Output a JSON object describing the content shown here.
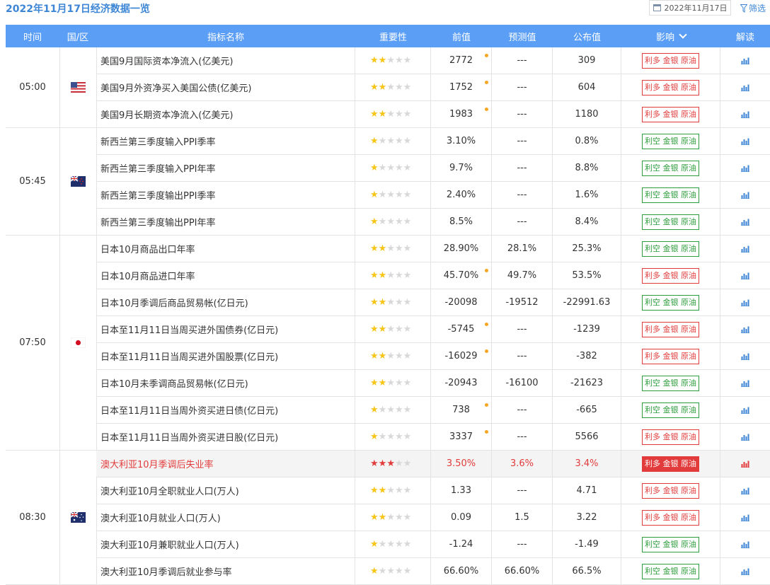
{
  "page_title": "2022年11月17日经济数据一览",
  "date_picker": {
    "value": "2022年11月17日"
  },
  "filter_label": "筛选",
  "columns": [
    "时间",
    "国/区",
    "指标名称",
    "重要性",
    "前值",
    "预测值",
    "公布值",
    "影响",
    "解读"
  ],
  "colors": {
    "header_bg": "#5b9ef5",
    "title": "#3d86d6",
    "bullish": "#e23b3b",
    "bearish": "#2d9d3c",
    "star": "#f5c518",
    "revised_dot": "#f5a623"
  },
  "groups": [
    {
      "time": "05:00",
      "flag": "us-flag-icon",
      "rows": 3
    },
    {
      "time": "05:45",
      "flag": "nz-flag-icon",
      "rows": 4
    },
    {
      "time": "07:50",
      "flag": "jp-flag-icon",
      "rows": 8
    },
    {
      "time": "08:30",
      "flag": "au-flag-icon",
      "rows": 5
    }
  ],
  "rows": [
    {
      "name": "美国9月国际资本净流入(亿美元)",
      "stars": 2,
      "prev": "2772",
      "revised": true,
      "forecast": "---",
      "actual": "309",
      "impact": "利多 金银 原油",
      "impact_type": "red",
      "highlight": false
    },
    {
      "name": "美国9月外资净买入美国公债(亿美元)",
      "stars": 2,
      "prev": "1752",
      "revised": true,
      "forecast": "---",
      "actual": "604",
      "impact": "利多 金银 原油",
      "impact_type": "red",
      "highlight": false
    },
    {
      "name": "美国9月长期资本净流入(亿美元)",
      "stars": 2,
      "prev": "1983",
      "revised": true,
      "forecast": "---",
      "actual": "1180",
      "impact": "利多 金银 原油",
      "impact_type": "red",
      "highlight": false
    },
    {
      "name": "新西兰第三季度输入PPI季率",
      "stars": 1,
      "prev": "3.10%",
      "revised": false,
      "forecast": "---",
      "actual": "0.8%",
      "impact": "利空 金银 原油",
      "impact_type": "green",
      "highlight": false
    },
    {
      "name": "新西兰第三季度输入PPI年率",
      "stars": 1,
      "prev": "9.7%",
      "revised": false,
      "forecast": "---",
      "actual": "8.8%",
      "impact": "利空 金银 原油",
      "impact_type": "green",
      "highlight": false
    },
    {
      "name": "新西兰第三季度输出PPI季率",
      "stars": 1,
      "prev": "2.40%",
      "revised": false,
      "forecast": "---",
      "actual": "1.6%",
      "impact": "利空 金银 原油",
      "impact_type": "green",
      "highlight": false
    },
    {
      "name": "新西兰第三季度输出PPI年率",
      "stars": 1,
      "prev": "8.5%",
      "revised": false,
      "forecast": "---",
      "actual": "8.4%",
      "impact": "利空 金银 原油",
      "impact_type": "green",
      "highlight": false
    },
    {
      "name": "日本10月商品出口年率",
      "stars": 2,
      "prev": "28.90%",
      "revised": false,
      "forecast": "28.1%",
      "actual": "25.3%",
      "impact": "利空 金银 原油",
      "impact_type": "green",
      "highlight": false
    },
    {
      "name": "日本10月商品进口年率",
      "stars": 2,
      "prev": "45.70%",
      "revised": true,
      "forecast": "49.7%",
      "actual": "53.5%",
      "impact": "利多 金银 原油",
      "impact_type": "red",
      "highlight": false
    },
    {
      "name": "日本10月季调后商品贸易帐(亿日元)",
      "stars": 2,
      "prev": "-20098",
      "revised": false,
      "forecast": "-19512",
      "actual": "-22991.63",
      "impact": "利空 金银 原油",
      "impact_type": "green",
      "highlight": false
    },
    {
      "name": "日本至11月11日当周买进外国债券(亿日元)",
      "stars": 2,
      "prev": "-5745",
      "revised": true,
      "forecast": "---",
      "actual": "-1239",
      "impact": "利多 金银 原油",
      "impact_type": "red",
      "highlight": false
    },
    {
      "name": "日本至11月11日当周买进外国股票(亿日元)",
      "stars": 2,
      "prev": "-16029",
      "revised": true,
      "forecast": "---",
      "actual": "-382",
      "impact": "利多 金银 原油",
      "impact_type": "red",
      "highlight": false
    },
    {
      "name": "日本10月未季调商品贸易帐(亿日元)",
      "stars": 2,
      "prev": "-20943",
      "revised": false,
      "forecast": "-16100",
      "actual": "-21623",
      "impact": "利空 金银 原油",
      "impact_type": "green",
      "highlight": false
    },
    {
      "name": "日本至11月11日当周外资买进日债(亿日元)",
      "stars": 1,
      "prev": "738",
      "revised": true,
      "forecast": "---",
      "actual": "-665",
      "impact": "利空 金银 原油",
      "impact_type": "green",
      "highlight": false
    },
    {
      "name": "日本至11月11日当周外资买进日股(亿日元)",
      "stars": 1,
      "prev": "3337",
      "revised": true,
      "forecast": "---",
      "actual": "5566",
      "impact": "利多 金银 原油",
      "impact_type": "red",
      "highlight": false
    },
    {
      "name": "澳大利亚10月季调后失业率",
      "stars": 3,
      "prev": "3.50%",
      "revised": false,
      "forecast": "3.6%",
      "actual": "3.4%",
      "impact": "利多 金银 原油",
      "impact_type": "redfill",
      "highlight": true
    },
    {
      "name": "澳大利亚10月全职就业人口(万人)",
      "stars": 2,
      "prev": "1.33",
      "revised": false,
      "forecast": "---",
      "actual": "4.71",
      "impact": "利多 金银 原油",
      "impact_type": "red",
      "highlight": false
    },
    {
      "name": "澳大利亚10月就业人口(万人)",
      "stars": 2,
      "prev": "0.09",
      "revised": false,
      "forecast": "1.5",
      "actual": "3.22",
      "impact": "利多 金银 原油",
      "impact_type": "red",
      "highlight": false
    },
    {
      "name": "澳大利亚10月兼职就业人口(万人)",
      "stars": 1,
      "prev": "-1.24",
      "revised": false,
      "forecast": "---",
      "actual": "-1.49",
      "impact": "利空 金银 原油",
      "impact_type": "green",
      "highlight": false
    },
    {
      "name": "澳大利亚10月季调后就业参与率",
      "stars": 1,
      "prev": "66.60%",
      "revised": false,
      "forecast": "66.60%",
      "actual": "66.5%",
      "impact": "利空 金银 原油",
      "impact_type": "green",
      "highlight": false
    }
  ]
}
